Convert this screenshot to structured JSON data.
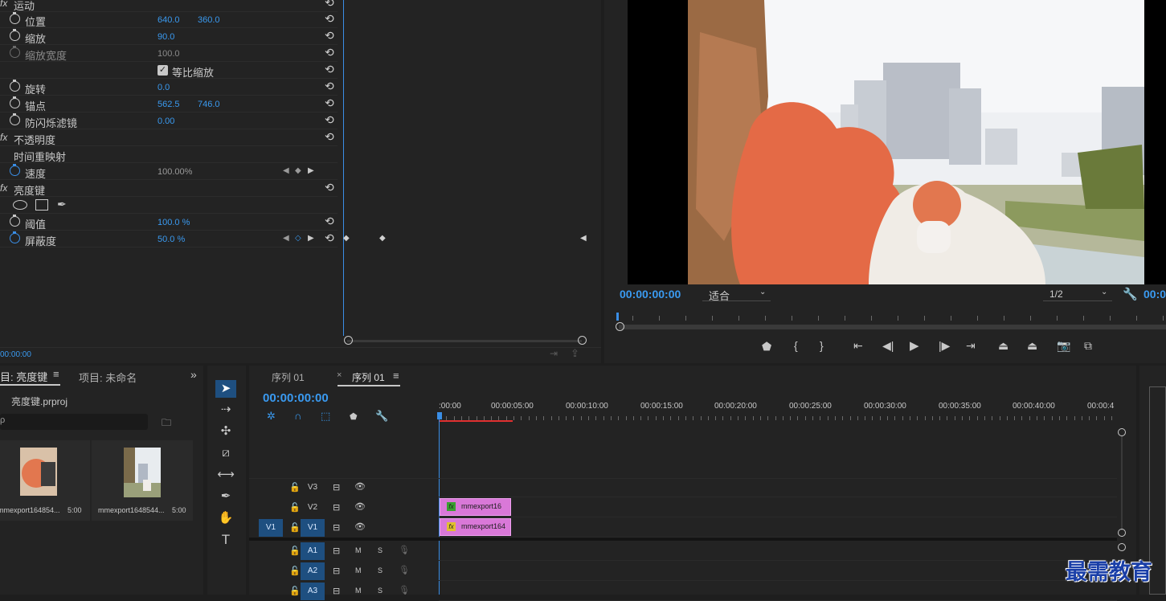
{
  "effects": {
    "motion_label": "运动",
    "params": {
      "position": {
        "label": "位置",
        "x": "640.0",
        "y": "360.0"
      },
      "scale": {
        "label": "缩放",
        "value": "90.0"
      },
      "scale_width": {
        "label": "缩放宽度",
        "value": "100.0"
      },
      "uniform_scale": {
        "label": "等比缩放",
        "checked": true
      },
      "rotation": {
        "label": "旋转",
        "value": "0.0"
      },
      "anchor": {
        "label": "锚点",
        "x": "562.5",
        "y": "746.0"
      },
      "antiflicker": {
        "label": "防闪烁滤镜",
        "value": "0.00"
      }
    },
    "opacity_label": "不透明度",
    "time_remap_label": "时间重映射",
    "speed": {
      "label": "速度",
      "value": "100.00%"
    },
    "luma_key_label": "亮度键",
    "threshold": {
      "label": "阈值",
      "value": "100.0 %"
    },
    "cutoff": {
      "label": "屏蔽度",
      "value": "50.0 %"
    },
    "fx_icon": "fx",
    "timecode": "00:00:00"
  },
  "program": {
    "timecode": "00:00:00:00",
    "fit_option": "适合",
    "resolution": "1/2",
    "timecode_right": "00:0",
    "accent": "#3a9af0"
  },
  "project": {
    "tab_active": "目: 亮度键",
    "tab_other": "项目: 未命名",
    "file_name": "亮度键.prproj",
    "items": [
      {
        "name": "mmexport164854...",
        "duration": "5:00"
      },
      {
        "name": "mmexport1648544...",
        "duration": "5:00"
      }
    ]
  },
  "timeline": {
    "tab_inactive": "序列 01",
    "tab_active": "序列 01",
    "timecode": "00:00:00:00",
    "ruler": [
      ":00:00",
      "00:00:05:00",
      "00:00:10:00",
      "00:00:15:00",
      "00:00:20:00",
      "00:00:25:00",
      "00:00:30:00",
      "00:00:35:00",
      "00:00:40:00",
      "00:00:4"
    ],
    "video_tracks": [
      {
        "source": "",
        "name": "V3"
      },
      {
        "source": "",
        "name": "V2"
      },
      {
        "source": "V1",
        "name": "V1"
      }
    ],
    "audio_tracks": [
      {
        "name": "A1",
        "m": "M",
        "s": "S"
      },
      {
        "name": "A2",
        "m": "M",
        "s": "S"
      },
      {
        "name": "A3",
        "m": "M",
        "s": "S"
      }
    ],
    "clips": [
      {
        "track": "V2",
        "label": "mmexport16"
      },
      {
        "track": "V1",
        "label": "mmexport164"
      }
    ],
    "clip_color": "#d978d8"
  },
  "watermark": "最需教育"
}
